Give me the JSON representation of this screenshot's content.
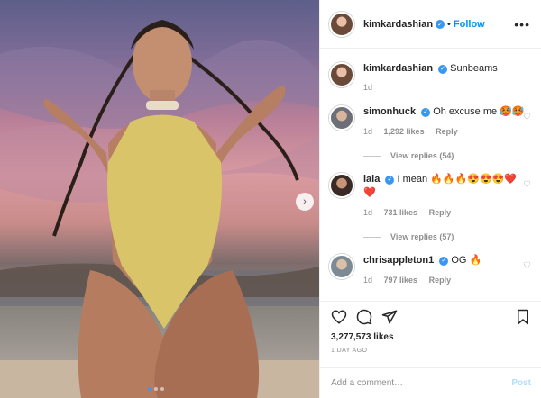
{
  "post": {
    "photo_alt": "Woman in a yellow halter swimsuit posing at sunset on a beach",
    "slide_count": 3,
    "active_slide": 1
  },
  "header": {
    "username": "kimkardashian",
    "separator": "•",
    "follow_label": "Follow",
    "more_label": "•••"
  },
  "caption": {
    "username": "kimkardashian",
    "text": "Sunbeams",
    "time": "1d"
  },
  "comments": [
    {
      "username": "simonhuck",
      "text": "Oh excuse me",
      "emoji": "🥵🥵",
      "time": "1d",
      "likes": "1,292 likes",
      "reply_label": "Reply",
      "view_replies": "View replies (54)"
    },
    {
      "username": "lala",
      "text": "I mean",
      "emoji": "🔥🔥🔥😍😍😍❤️",
      "emoji2": "❤️",
      "time": "1d",
      "likes": "731 likes",
      "reply_label": "Reply",
      "view_replies": "View replies (57)"
    },
    {
      "username": "chrisappleton1",
      "text": "OG",
      "emoji": "🔥",
      "time": "1d",
      "likes": "797 likes",
      "reply_label": "Reply"
    }
  ],
  "actions": {
    "likes": "3,277,573 likes",
    "date": "1 DAY AGO"
  },
  "add_comment": {
    "placeholder": "Add a comment…",
    "post_label": "Post"
  },
  "colors": {
    "accent": "#3897f0",
    "follow": "#0095f6",
    "swimsuit": "#d9c46a"
  }
}
